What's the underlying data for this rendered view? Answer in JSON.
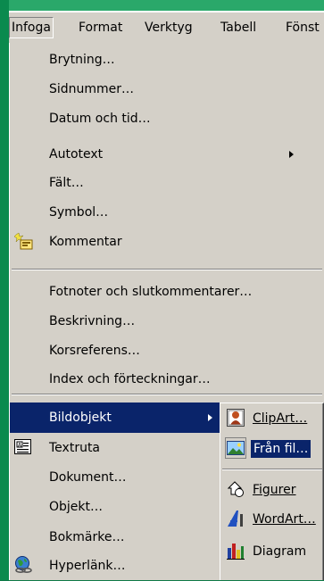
{
  "menubar": {
    "items": [
      {
        "label": "Infoga"
      },
      {
        "label": "Format"
      },
      {
        "label": "Verktyg"
      },
      {
        "label": "Tabell"
      },
      {
        "label": "Fönst"
      }
    ]
  },
  "menu": {
    "items": [
      {
        "label": "Brytning…"
      },
      {
        "label": "Sidnummer…"
      },
      {
        "label": "Datum och tid…"
      },
      {
        "label": "Autotext"
      },
      {
        "label": "Fält…"
      },
      {
        "label": "Symbol…"
      },
      {
        "label": "Kommentar"
      },
      {
        "label": "Fotnoter och slutkommentarer…"
      },
      {
        "label": "Beskrivning…"
      },
      {
        "label": "Korsreferens…"
      },
      {
        "label": "Index och förteckningar…"
      },
      {
        "label": "Bildobjekt"
      },
      {
        "label": "Textruta"
      },
      {
        "label": "Dokument…"
      },
      {
        "label": "Objekt…"
      },
      {
        "label": "Bokmärke…"
      },
      {
        "label": "Hyperlänk…"
      }
    ]
  },
  "submenu": {
    "items": [
      {
        "label": "ClipArt…"
      },
      {
        "label": "Från fil…"
      },
      {
        "label": "Figurer"
      },
      {
        "label": "WordArt…"
      },
      {
        "label": "Diagram"
      }
    ]
  },
  "colors": {
    "menu_bg": "#d4d0c8",
    "highlight": "#0a246a",
    "backdrop_green": "#0f7a48"
  }
}
